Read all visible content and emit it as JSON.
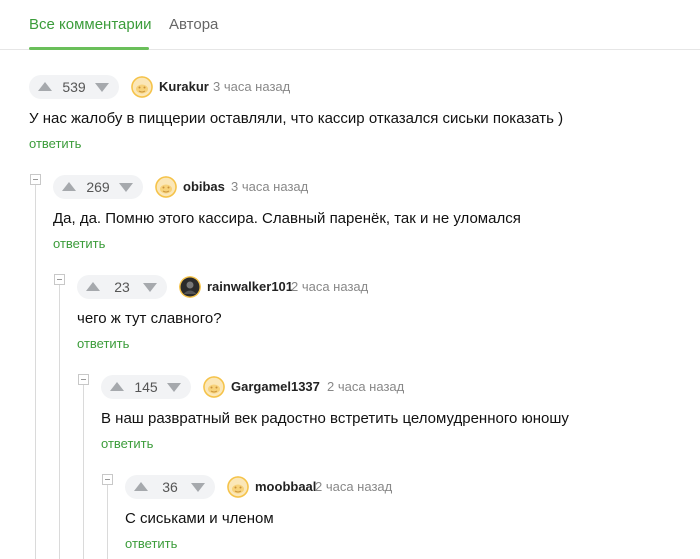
{
  "tabs": {
    "all": "Все комментарии",
    "author": "Автора"
  },
  "comments": [
    {
      "votes": "539",
      "user": "Kurakur",
      "time": "3 часа назад",
      "text": "У нас жалобу в пиццерии оставляли, что кассир отказался сиськи показать )",
      "reply": "ответить",
      "avatar": "pikabu-default-avatar"
    },
    {
      "votes": "269",
      "user": "obibas",
      "time": "3 часа назад",
      "text": "Да, да. Помню этого кассира. Славный паренёк, так и не уломался",
      "reply": "ответить",
      "avatar": "pikabu-default-avatar"
    },
    {
      "votes": "23",
      "user": "rainwalker101",
      "time": "2 часа назад",
      "text": "чего ж тут славного?",
      "reply": "ответить",
      "avatar": "user-photo-avatar"
    },
    {
      "votes": "145",
      "user": "Gargamel1337",
      "time": "2 часа назад",
      "text": "В наш развратный век радостно встретить целомудренного юношу",
      "reply": "ответить",
      "avatar": "pikabu-default-avatar"
    },
    {
      "votes": "36",
      "user": "moobbaal",
      "time": "2 часа назад",
      "text": "С сиськами и членом",
      "reply": "ответить",
      "avatar": "pikabu-default-avatar"
    }
  ],
  "colors": {
    "accent": "#3b9c3a",
    "tab_underline": "#6abf5a",
    "vote_bg": "#f2f3f5"
  }
}
